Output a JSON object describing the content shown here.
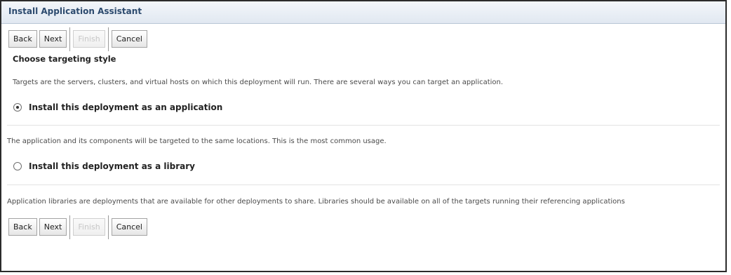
{
  "window": {
    "title": "Install Application Assistant"
  },
  "toolbar_top": {
    "back": "Back",
    "next": "Next",
    "finish": "Finish",
    "cancel": "Cancel"
  },
  "toolbar_bottom": {
    "back": "Back",
    "next": "Next",
    "finish": "Finish",
    "cancel": "Cancel"
  },
  "section": {
    "title": "Choose targeting style",
    "description": "Targets are the servers, clusters, and virtual hosts on which this deployment will run. There are several ways you can target an application."
  },
  "options": [
    {
      "label": "Install this deployment as an application",
      "selected": true,
      "description": "The application and its components will be targeted to the same locations. This is the most common usage."
    },
    {
      "label": "Install this deployment as a library",
      "selected": false,
      "description": "Application libraries are deployments that are available for other deployments to share. Libraries should be available on all of the targets running their referencing applications"
    }
  ]
}
